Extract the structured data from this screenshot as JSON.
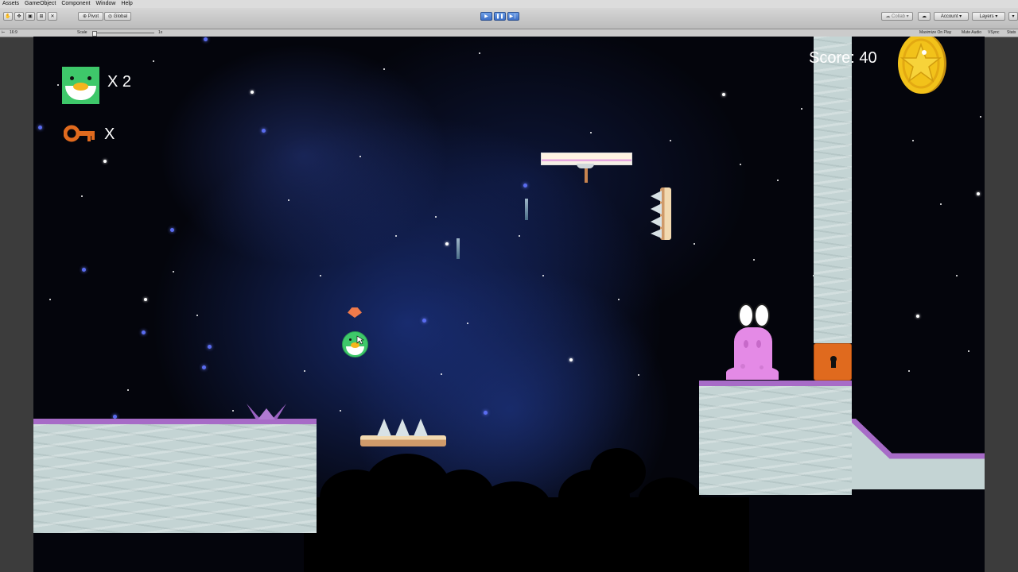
{
  "menu": [
    "Assets",
    "GameObject",
    "Component",
    "Window",
    "Help"
  ],
  "toolbar": {
    "pivot": "Pivot",
    "global": "Global",
    "collab": "Collab",
    "account": "Account",
    "layers": "Layers"
  },
  "gamebar": {
    "aspect": "16:9",
    "scale_label": "Scale",
    "scale_value": "1x",
    "maximize": "Maximize On Play",
    "mute": "Mute Audio",
    "vsync": "VSync",
    "stats": "Stats"
  },
  "hud": {
    "lives": "X 2",
    "keys": "X",
    "score": "Score: 40"
  },
  "colors": {
    "accent": "#3d6fc6",
    "platform_top": "#a76bc7",
    "platform": "#c4d4d4",
    "lock_block": "#e06a1e",
    "enemy": "#e48ae6",
    "coin": "#f2c21a"
  }
}
